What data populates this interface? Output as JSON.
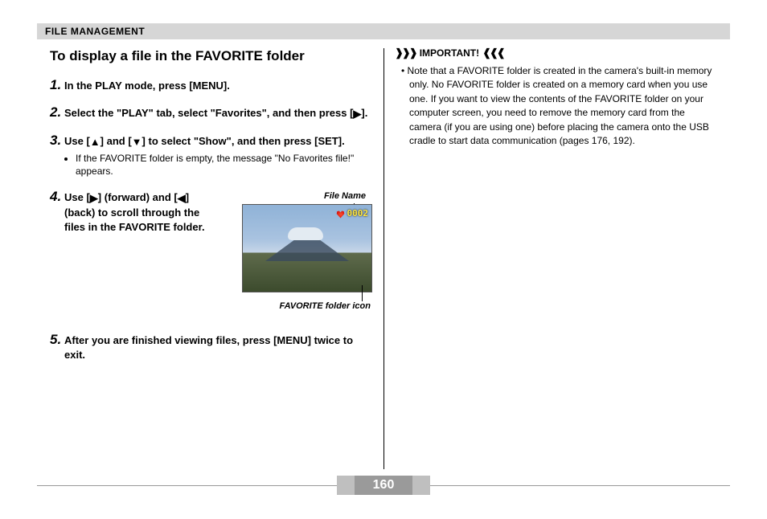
{
  "header": {
    "section": "FILE MANAGEMENT"
  },
  "left": {
    "title": "To display a file in the FAVORITE folder",
    "steps": {
      "s1": {
        "num": "1.",
        "text": "In the PLAY mode, press [MENU]."
      },
      "s2": {
        "num": "2.",
        "text_a": "Select the \"PLAY\" tab, select \"Favorites\", and then press [",
        "text_b": "]."
      },
      "s3": {
        "num": "3.",
        "text_a": "Use [",
        "text_b": "] and [",
        "text_c": "] to select \"Show\", and then press [SET].",
        "note": "If the FAVORITE folder is empty, the message \"No Favorites file!\" appears."
      },
      "s4": {
        "num": "4.",
        "text_a": "Use [",
        "text_b": "] (forward) and [",
        "text_c": "] (back) to scroll through the files in the FAVORITE folder.",
        "figure": {
          "label_top": "File Name",
          "file_number": "0002",
          "caption": "FAVORITE folder icon"
        }
      },
      "s5": {
        "num": "5.",
        "text": "After you are finished viewing files, press [MENU] twice to exit."
      }
    }
  },
  "right": {
    "important_label": "IMPORTANT!",
    "bullet_prefix": "• ",
    "body": "Note that a FAVORITE folder is created in the camera's built-in memory only. No FAVORITE folder is created on a memory card when you use one. If you want to view the contents of the FAVORITE folder on your computer screen, you need to remove the memory card from the camera (if you are using one) before placing the camera onto the USB cradle to start data communication (pages 176, 192)."
  },
  "page_number": "160",
  "glyphs": {
    "right_arrows": "❱❱❱",
    "left_arrows": "❰❰❰"
  }
}
